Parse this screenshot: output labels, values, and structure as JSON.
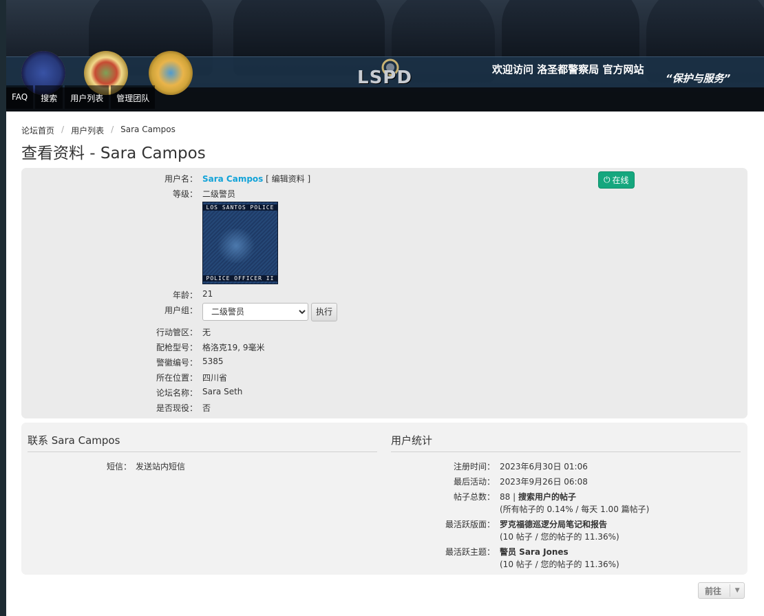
{
  "header": {
    "welcome": "欢迎访问 洛圣都警察局 官方网站",
    "motto": "“保护与服务”",
    "logo_text": "LSPD",
    "nav": [
      "FAQ",
      "搜索",
      "用户列表",
      "管理团队"
    ]
  },
  "breadcrumb": [
    "论坛首页",
    "用户列表",
    "Sara Campos"
  ],
  "page_title": "查看资料 - Sara Campos",
  "profile": {
    "username_label": "用户名：",
    "username": "Sara Campos",
    "edit_link": "[ 编辑资料 ]",
    "online": "在线",
    "rank_label": "等级：",
    "rank": "二级警员",
    "rank_image_top": "LOS SANTOS POLICE",
    "rank_image_bottom": "POLICE OFFICER II",
    "age_label": "年龄：",
    "age": "21",
    "group_label": "用户组：",
    "group_selected": "二级警员",
    "exec_button": "执行",
    "fields": [
      {
        "label": "行动管区：",
        "value": "无"
      },
      {
        "label": "配枪型号：",
        "value": "格洛克19, 9毫米"
      },
      {
        "label": "警徽编号：",
        "value": "5385"
      },
      {
        "label": "所在位置：",
        "value": "四川省"
      },
      {
        "label": "论坛名称：",
        "value": "Sara Seth"
      },
      {
        "label": "是否现役：",
        "value": "否"
      }
    ]
  },
  "contact": {
    "title": "联系 Sara Campos",
    "pm_label": "短信：",
    "pm_value": "发送站内短信"
  },
  "stats": {
    "title": "用户统计",
    "joined_label": "注册时间：",
    "joined": "2023年6月30日 01:06",
    "last_active_label": "最后活动：",
    "last_active": "2023年9月26日 06:08",
    "posts_label": "帖子总数：",
    "posts_count": "88",
    "posts_sep": " | ",
    "posts_search": "搜索用户的帖子",
    "posts_detail": "(所有帖子的 0.14% / 每天 1.00 篇帖子)",
    "active_forum_label": "最活跃版面：",
    "active_forum": "罗克福德巡逻分局笔记和报告",
    "active_forum_detail": "(10 帖子 / 您的帖子的 11.36%)",
    "active_topic_label": "最活跃主题：",
    "active_topic": "警员 Sara Jones",
    "active_topic_detail": "(10 帖子 / 您的帖子的 11.36%)"
  },
  "jumpbox": {
    "label": "前往"
  }
}
